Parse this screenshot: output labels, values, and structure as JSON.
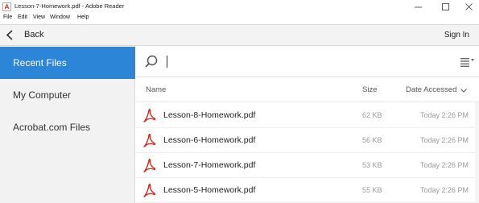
{
  "window": {
    "title": "Lesson-7-Homework.pdf - Adobe Reader",
    "minimize_glyph": "—",
    "maximize_glyph": "☐",
    "close_glyph": "✕"
  },
  "menu": {
    "items": [
      "File",
      "Edit",
      "View",
      "Window",
      "Help"
    ]
  },
  "toolbar": {
    "back_label": "Back",
    "signin_label": "Sign In"
  },
  "sidebar": {
    "items": [
      {
        "label": "Recent Files",
        "active": true
      },
      {
        "label": "My Computer",
        "active": false
      },
      {
        "label": "Acrobat.com Files",
        "active": false
      }
    ]
  },
  "search": {
    "value": "",
    "placeholder": ""
  },
  "table": {
    "headers": {
      "name": "Name",
      "size": "Size",
      "date": "Date Accessed"
    },
    "rows": [
      {
        "name": "Lesson-8-Homework.pdf",
        "size": "62 KB",
        "date": "Today 2:26 PM"
      },
      {
        "name": "Lesson-6-Homework.pdf",
        "size": "56 KB",
        "date": "Today 2:26 PM"
      },
      {
        "name": "Lesson-7-Homework.pdf",
        "size": "53 KB",
        "date": "Today 2:26 PM"
      },
      {
        "name": "Lesson-5-Homework.pdf",
        "size": "55 KB",
        "date": "Today 2:26 PM"
      }
    ]
  },
  "colors": {
    "accent": "#2d85d7",
    "pdf_red": "#d7261d"
  },
  "icons": [
    "app-icon",
    "back-arrow-icon",
    "search-icon",
    "list-view-icon",
    "sort-down-icon",
    "pdf-file-icon"
  ]
}
